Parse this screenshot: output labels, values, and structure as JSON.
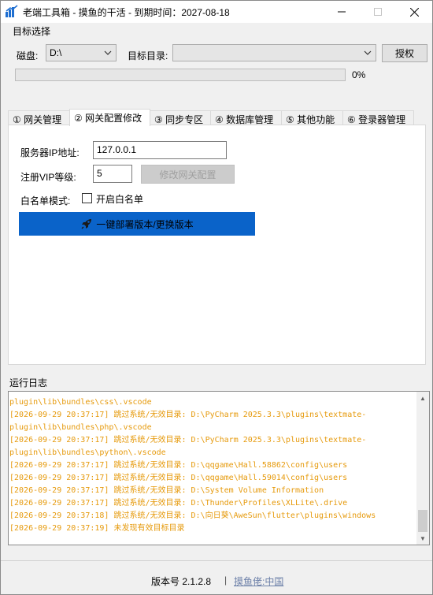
{
  "window": {
    "title": "老端工具箱 - 摸鱼的干活 - 到期时间：2027-08-18",
    "minimize_icon": "minimize-icon",
    "maximize_icon": "maximize-icon",
    "close_icon": "close-icon"
  },
  "target": {
    "group_label": "目标选择",
    "disk_label": "磁盘:",
    "disk_value": "D:\\",
    "dir_label": "目标目录:",
    "dir_value": "",
    "authorize_label": "授权",
    "progress_percent": 0,
    "progress_text": "0%"
  },
  "tabs": [
    {
      "label": "① 网关管理"
    },
    {
      "label": "② 网关配置修改"
    },
    {
      "label": "③ 同步专区"
    },
    {
      "label": "④ 数据库管理"
    },
    {
      "label": "⑤ 其他功能"
    },
    {
      "label": "⑥ 登录器管理"
    }
  ],
  "active_tab_index": 1,
  "gateway_config": {
    "ip_label": "服务器IP地址:",
    "ip_value": "127.0.0.1",
    "vip_label": "注册VIP等级:",
    "vip_value": "5",
    "modify_label": "修改网关配置",
    "whitelist_mode_label": "白名单模式:",
    "whitelist_checkbox_label": "开启白名单",
    "whitelist_checked": false,
    "deploy_label": "一键部署版本/更换版本",
    "deploy_icon": "rocket-icon"
  },
  "log": {
    "label": "运行日志",
    "lines": [
      "plugin\\lib\\bundles\\css\\.vscode",
      "[2026-09-29 20:37:17] 跳过系统/无效目录: D:\\PyCharm 2025.3.3\\plugins\\textmate-",
      "plugin\\lib\\bundles\\php\\.vscode",
      "[2026-09-29 20:37:17] 跳过系统/无效目录: D:\\PyCharm 2025.3.3\\plugins\\textmate-",
      "plugin\\lib\\bundles\\python\\.vscode",
      "[2026-09-29 20:37:17] 跳过系统/无效目录: D:\\qqgame\\Hall.58862\\config\\users",
      "[2026-09-29 20:37:17] 跳过系统/无效目录: D:\\qqgame\\Hall.59014\\config\\users",
      "[2026-09-29 20:37:17] 跳过系统/无效目录: D:\\System Volume Information",
      "[2026-09-29 20:37:17] 跳过系统/无效目录: D:\\Thunder\\Profiles\\XLLite\\.drive",
      "[2026-09-29 20:37:18] 跳过系统/无效目录: D:\\向日葵\\AweSun\\flutter\\plugins\\windows",
      "[2026-09-29 20:37:19] 未发现有效目标目录"
    ]
  },
  "footer": {
    "version": "版本号 2.1.2.8",
    "separator": "|",
    "link": "摸鱼佬:中国"
  },
  "colors": {
    "log_text": "#e69a0c",
    "deploy_button": "#0a63c9",
    "link": "#6b7fa8"
  }
}
